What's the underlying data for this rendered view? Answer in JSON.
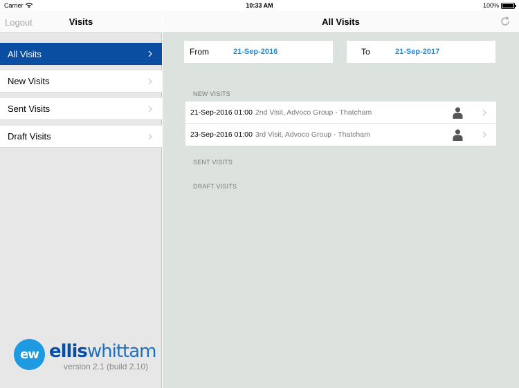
{
  "status_bar": {
    "carrier": "Carrier",
    "time": "10:33 AM",
    "battery": "100%"
  },
  "left_panel": {
    "logout_label": "Logout",
    "title": "Visits",
    "menu": [
      {
        "label": "All Visits",
        "active": true
      },
      {
        "label": "New Visits",
        "active": false
      },
      {
        "label": "Sent Visits",
        "active": false
      },
      {
        "label": "Draft Visits",
        "active": false
      }
    ],
    "logo": {
      "badge": "ew",
      "brand_bold": "ellis",
      "brand_light": "whittam",
      "version": "version 2.1 (build 2.10)"
    }
  },
  "main": {
    "title": "All Visits",
    "refresh_icon": "refresh-icon",
    "from": {
      "label": "From",
      "value": "21-Sep-2016"
    },
    "to": {
      "label": "To",
      "value": "21-Sep-2017"
    },
    "sections": {
      "new": "NEW VISITS",
      "sent": "SENT VISITS",
      "draft": "DRAFT VISITS"
    },
    "new_visits": [
      {
        "datetime": "21-Sep-2016 01:00",
        "description": "2nd Visit, Advoco Group - Thatcham"
      },
      {
        "datetime": "23-Sep-2016 01:00",
        "description": "3rd Visit, Advoco Group - Thatcham"
      }
    ]
  },
  "colors": {
    "accent_blue": "#0a4ea1",
    "date_blue": "#1e8ce0",
    "logo_cyan": "#1e9be0",
    "content_bg": "#dce3df"
  }
}
